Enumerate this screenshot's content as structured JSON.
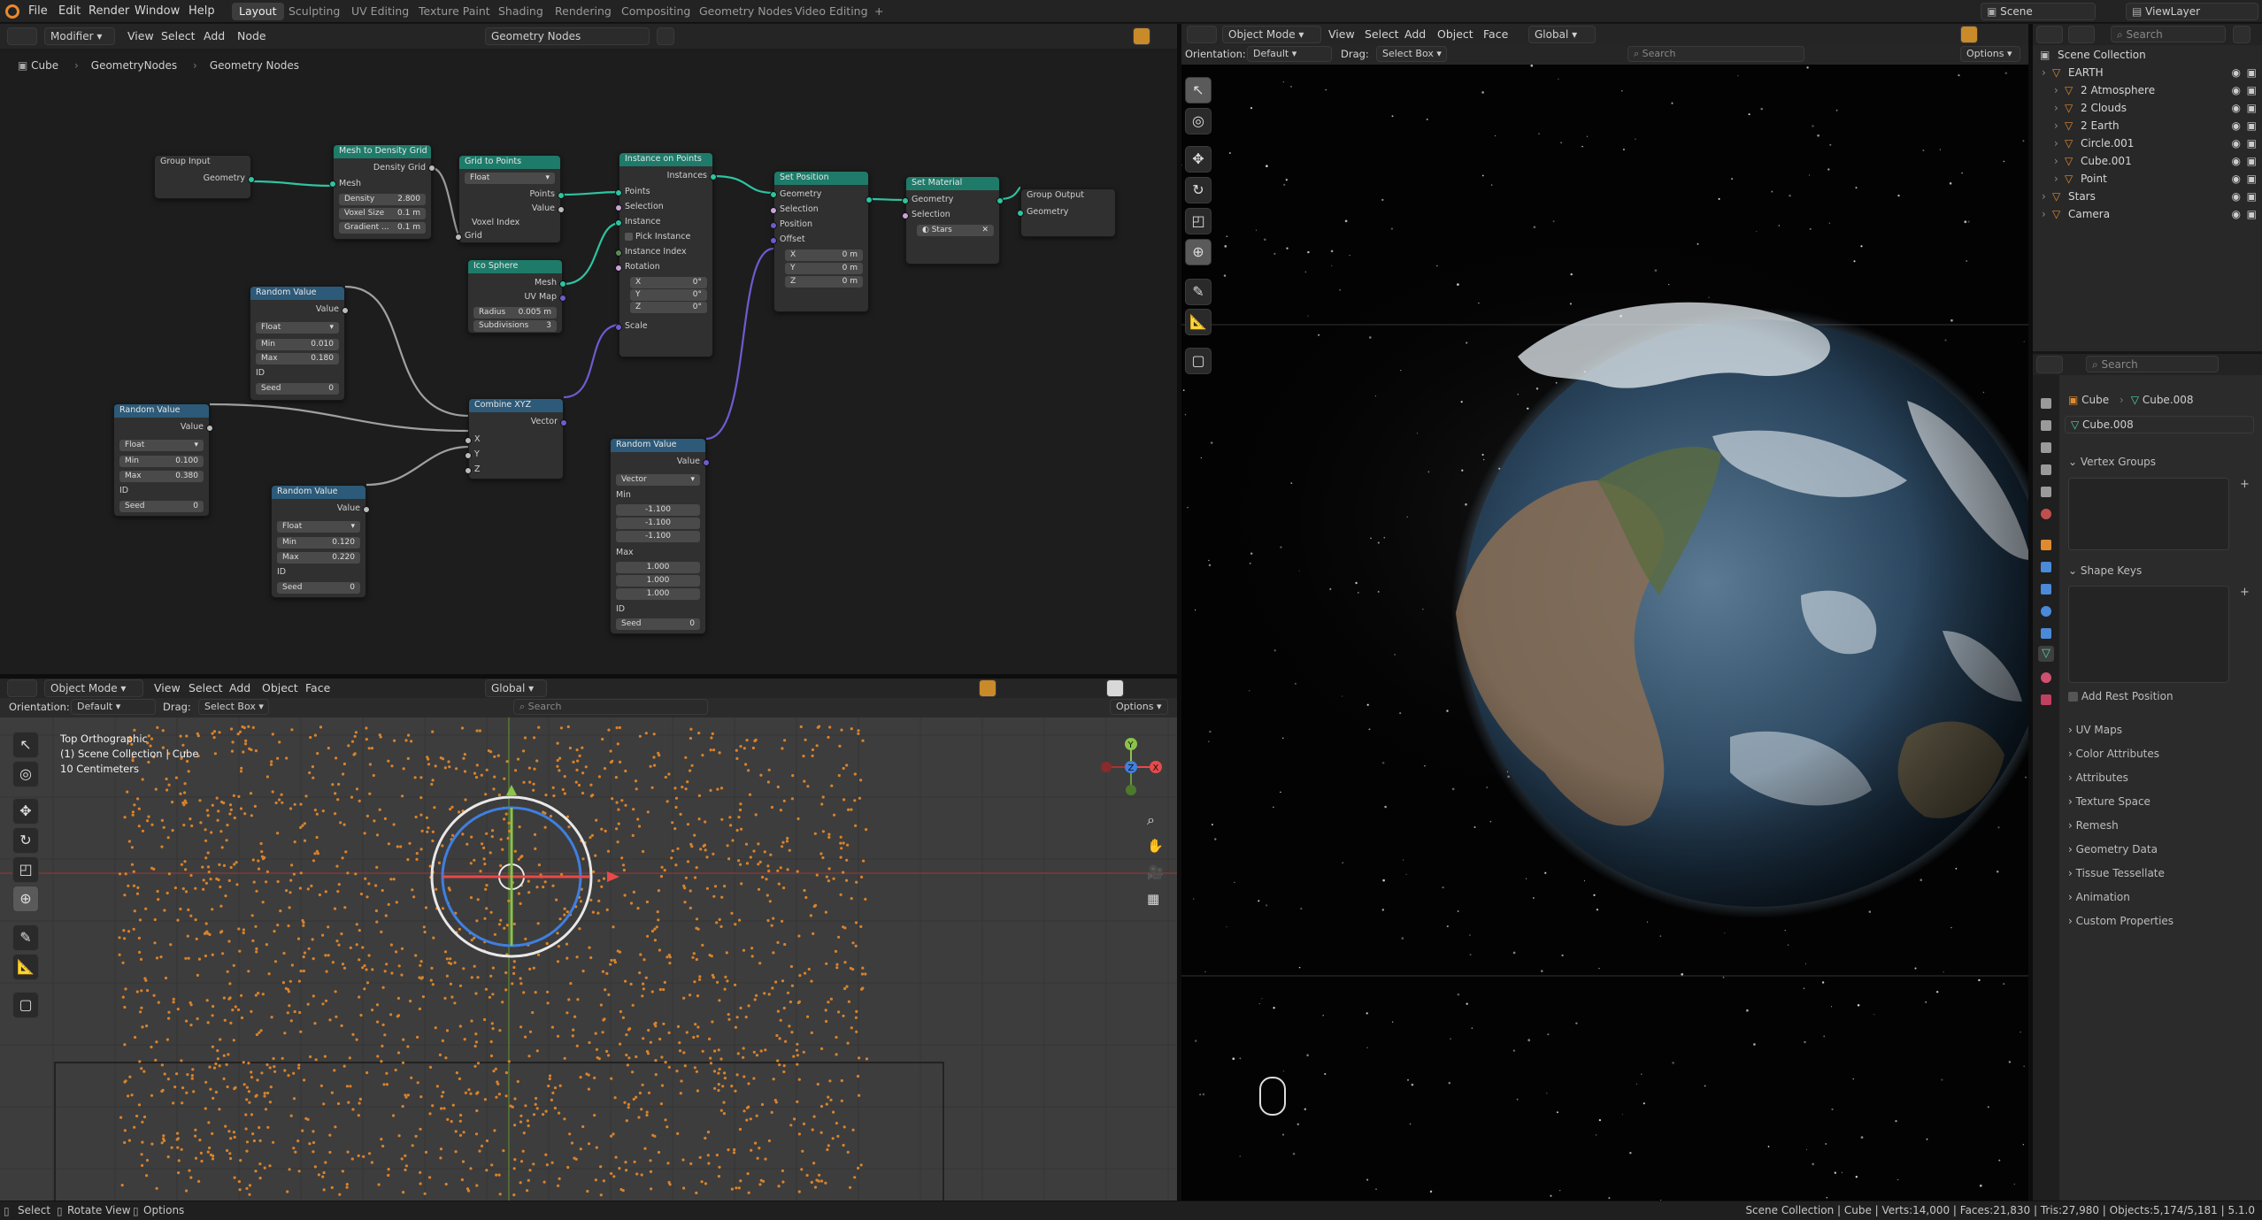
{
  "top_menu": [
    "File",
    "Edit",
    "Render",
    "Window",
    "Help"
  ],
  "workspace_tabs": [
    "Layout",
    "Sculpting",
    "UV Editing",
    "Texture Paint",
    "Shading",
    "Rendering",
    "Compositing",
    "Geometry Nodes",
    "Video Editing"
  ],
  "active_tab": "Layout",
  "scene_name": "Scene",
  "view_layer": "ViewLayer",
  "node_editor": {
    "header": {
      "mode": "Modifier",
      "menus": [
        "View",
        "Select",
        "Add",
        "Node"
      ],
      "tree": "Geometry Nodes"
    },
    "breadcrumb": [
      "Cube",
      "GeometryNodes",
      "Geometry Nodes"
    ],
    "nodes": {
      "group_input": {
        "title": "Group Input",
        "out": "Geometry"
      },
      "mesh_to_density": {
        "title": "Mesh to Density Grid",
        "out": "Density Grid",
        "mesh": "Mesh",
        "density_label": "Density",
        "density": "2.800",
        "voxel_label": "Voxel Size",
        "voxel": "0.1 m",
        "gradient_label": "Gradient ...",
        "gradient": "0.1 m"
      },
      "grid_to_points": {
        "title": "Grid to Points",
        "dtype": "Float",
        "points": "Points",
        "value": "Value",
        "voxel_index": "Voxel Index",
        "grid": "Grid"
      },
      "instance_on_points": {
        "title": "Instance on Points",
        "out": "Instances",
        "points": "Points",
        "selection": "Selection",
        "instance": "Instance",
        "pick": "Pick Instance",
        "index": "Instance Index",
        "rotation": "Rotation",
        "rx": "X",
        "ry": "Y",
        "rz": "Z",
        "rxv": "0°",
        "ryv": "0°",
        "rzv": "0°",
        "scale": "Scale"
      },
      "set_position": {
        "title": "Set Position",
        "geometry": "Geometry",
        "selection": "Selection",
        "position": "Position",
        "offset": "Offset",
        "x": "X",
        "y": "Y",
        "z": "Z",
        "xv": "0 m",
        "yv": "0 m",
        "zv": "0 m"
      },
      "set_material": {
        "title": "Set Material",
        "geometry": "Geometry",
        "selection": "Selection",
        "material": "Stars"
      },
      "group_output": {
        "title": "Group Output",
        "in": "Geometry"
      },
      "ico_sphere": {
        "title": "Ico Sphere",
        "mesh": "Mesh",
        "uv": "UV Map",
        "radius_label": "Radius",
        "radius": "0.005 m",
        "subdiv_label": "Subdivisions",
        "subdiv": "3"
      },
      "random1": {
        "title": "Random Value",
        "value": "Value",
        "dtype": "Float",
        "min_label": "Min",
        "min": "0.010",
        "max_label": "Max",
        "max": "0.180",
        "id": "ID",
        "seed_label": "Seed",
        "seed": "0"
      },
      "random2": {
        "title": "Random Value",
        "value": "Value",
        "dtype": "Float",
        "min_label": "Min",
        "min": "0.100",
        "max_label": "Max",
        "max": "0.380",
        "id": "ID",
        "seed_label": "Seed",
        "seed": "0"
      },
      "random3": {
        "title": "Random Value",
        "value": "Value",
        "dtype": "Float",
        "min_label": "Min",
        "min": "0.120",
        "max_label": "Max",
        "max": "0.220",
        "id": "ID",
        "seed_label": "Seed",
        "seed": "0"
      },
      "combine_xyz": {
        "title": "Combine XYZ",
        "vector": "Vector",
        "x": "X",
        "y": "Y",
        "z": "Z"
      },
      "random_vec": {
        "title": "Random Value",
        "value": "Value",
        "dtype": "Vector",
        "min_label": "Min",
        "min": [
          "-1.100",
          "-1.100",
          "-1.100"
        ],
        "max_label": "Max",
        "max": [
          "1.000",
          "1.000",
          "1.000"
        ],
        "id": "ID",
        "seed_label": "Seed",
        "seed": "0"
      }
    }
  },
  "viewport_small": {
    "mode": "Object Mode",
    "menus": [
      "View",
      "Select",
      "Add",
      "Object",
      "Face"
    ],
    "transform": "Global",
    "orientation_label": "Orientation:",
    "orientation": "Default",
    "drag_label": "Drag:",
    "drag": "Select Box",
    "options": "Options",
    "overlay": [
      "Top Orthographic",
      "(1) Scene Collection | Cube",
      "10 Centimeters"
    ]
  },
  "viewport_render": {
    "mode": "Object Mode",
    "menus": [
      "View",
      "Select",
      "Add",
      "Object",
      "Face"
    ],
    "transform": "Global",
    "orientation_label": "Orientation:",
    "orientation": "Default",
    "drag_label": "Drag:",
    "drag": "Select Box",
    "options": "Options"
  },
  "outliner": {
    "title": "Scene Collection",
    "items": [
      {
        "name": "EARTH",
        "indent": 1
      },
      {
        "name": "2 Atmosphere",
        "indent": 2
      },
      {
        "name": "2 Clouds",
        "indent": 2
      },
      {
        "name": "2 Earth",
        "indent": 2
      },
      {
        "name": "Circle.001",
        "indent": 2
      },
      {
        "name": "Cube.001",
        "indent": 2
      },
      {
        "name": "Point",
        "indent": 2
      },
      {
        "name": "Stars",
        "indent": 1
      },
      {
        "name": "Camera",
        "indent": 1
      }
    ]
  },
  "properties": {
    "breadcrumb": [
      "Cube",
      "Cube.008"
    ],
    "data_name": "Cube.008",
    "panels": [
      "Vertex Groups",
      "Shape Keys"
    ],
    "add_rest": "Add Rest Position",
    "sections": [
      "UV Maps",
      "Color Attributes",
      "Attributes",
      "Texture Space",
      "Remesh",
      "Geometry Data",
      "Tissue Tessellate",
      "Animation",
      "Custom Properties"
    ]
  },
  "status": {
    "left": [
      "Select",
      "Rotate View",
      "Options"
    ],
    "right": "Scene Collection | Cube | Verts:14,000 | Faces:21,830 | Tris:27,980 | Objects:5,174/5,181 | 5.1.0"
  },
  "search_placeholder": "Search",
  "colors": {
    "accent": "#e8a33a",
    "geo_header": "#1e7b6a",
    "util_header": "#2c5a78",
    "green_link": "#2ec4a0",
    "point_orange": "#d9822b"
  }
}
